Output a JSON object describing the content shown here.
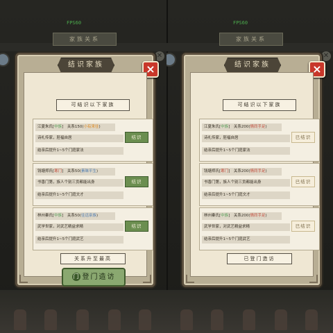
{
  "views": [
    {
      "fps": "FPS60",
      "bg_title": "家族关系",
      "panel_title": "结识家族",
      "header": "可结识以下家族",
      "families": [
        {
          "name": "江夏朱氏",
          "tag": "中族",
          "tag_color": "green",
          "relation_label": "关系值(",
          "relation": "关系150(",
          "relation_tag": "小有来往",
          "relation_tag_color": "orange",
          "desc": "诗礼传家，胚福自居",
          "note": "结亲后提升1~5个门庭家法",
          "action": "结识",
          "action_state": "available"
        },
        {
          "name": "钱塘郑氏",
          "tag": "寒门",
          "tag_color": "red",
          "relation": "关系50(",
          "relation_tag": "素昧平生",
          "relation_tag_color": "blue",
          "desc": "书香门第，族人个别三贡都能出身",
          "note": "结亲后提升1~5个门庭文才",
          "action": "结识",
          "action_state": "available"
        },
        {
          "name": "林州秦氏",
          "tag": "中族",
          "tag_color": "green",
          "relation": "关系50(",
          "relation_tag": "往远亲族",
          "relation_tag_color": "blue",
          "desc": "武学世家，对武艺精益求精",
          "note": "结亲后提升1~5个门庭武艺",
          "action": "结识",
          "action_state": "available"
        }
      ],
      "footer": "关系升至最高",
      "visit": "登门造访",
      "visit_icon": "门"
    },
    {
      "fps": "FPS60",
      "bg_title": "家族关系",
      "panel_title": "结识家族",
      "header": "可结识以下家族",
      "families": [
        {
          "name": "江夏朱氏",
          "tag": "中族",
          "tag_color": "green",
          "relation": "关系200(",
          "relation_tag": "情同手足",
          "relation_tag_color": "red",
          "desc": "诗礼传家，胚福自居",
          "note": "结亲后提升1~5个门庭家法",
          "action": "已结识",
          "action_state": "done"
        },
        {
          "name": "钱塘郑氏",
          "tag": "寒门",
          "tag_color": "red",
          "relation": "关系200(",
          "relation_tag": "情同手足",
          "relation_tag_color": "red",
          "desc": "书香门第，族人个别三贡都能出身",
          "note": "结亲后提升1~5个门庭文才",
          "action": "已结识",
          "action_state": "done"
        },
        {
          "name": "林州秦氏",
          "tag": "中族",
          "tag_color": "green",
          "relation": "关系200(",
          "relation_tag": "情同手足",
          "relation_tag_color": "red",
          "desc": "武学世家，对武艺精益求精",
          "note": "结亲后提升1~5个门庭武艺",
          "action": "已结识",
          "action_state": "done"
        }
      ],
      "footer": "已登门造访"
    }
  ]
}
